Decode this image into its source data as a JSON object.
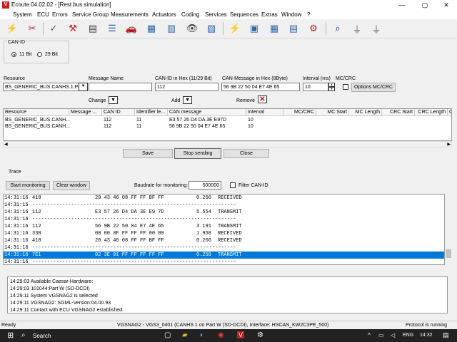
{
  "window": {
    "title": "Ecoute 04.02.02 - [Rest bus simulation]",
    "app_icon": "V",
    "minimize": "—",
    "maximize": "▢",
    "close": "✕"
  },
  "menu": [
    "System",
    "ECU",
    "Errors",
    "Service Group",
    "Measurements",
    "Actuators",
    "Coding",
    "Services",
    "Sequences",
    "Extras",
    "Window",
    "?"
  ],
  "canid": {
    "legend": "CAN-ID",
    "opt11": "11 Bit",
    "opt29": "29 Bit"
  },
  "form": {
    "resource_label": "Resource",
    "resource_value": "BS_GENERIC_BUS.CANHS.1.Part",
    "message_name_label": "Message Name",
    "message_name_value": "",
    "canid_hex_label": "CAN-ID in Hex (11/29 Bit)",
    "canid_hex_value": "112",
    "canmsg_label": "CAN-Message in Hex (8Byte)",
    "canmsg_value": "56 9B 22 50 04 E7 4E 65",
    "interval_label": "Interval (ms)",
    "interval_value": "10",
    "mccrc_label": "MC/CRC",
    "options_button": "Options MC/CRC",
    "change_label": "Change",
    "add_label": "Add",
    "remove_label": "Remove"
  },
  "grid": {
    "headers": [
      "Resource",
      "Message ...",
      "CAN ID",
      "Identifier le...",
      "CAN message",
      "Interval",
      "MC/CRC",
      "MC Start",
      "MC Length",
      "CRC Start",
      "CRC Length",
      "C"
    ],
    "rows": [
      {
        "resource": "BS_GENERIC_BUS.CANH...",
        "canid": "112",
        "idlen": "11",
        "msg": "E3 57 26 D4 DA 3E E97D",
        "interval": "10"
      },
      {
        "resource": "BS_GENERIC_BUS.CANH...",
        "canid": "112",
        "idlen": "11",
        "msg": "56 9B 22 50 04 E7 4E 65",
        "interval": "10"
      }
    ]
  },
  "actions": {
    "save": "Save",
    "stop": "Stop sending",
    "close": "Close"
  },
  "trace": {
    "title": "Trace",
    "start_button": "Start monitoring",
    "clear_button": "Clear window",
    "baud_label": "Baudrate for monitoring:",
    "baud_value": "500000",
    "filter_label": "Filter CAN-ID",
    "lines": [
      {
        "t": "14:31:16",
        "id": "418",
        "data": "20 43 46 08 FF FF BF FF",
        "val": "0.260",
        "dir": "RECEIVED",
        "sel": false
      },
      {
        "t": "14:31:16",
        "id": "--------------------------------------------------------------------",
        "data": "",
        "val": "",
        "dir": "",
        "sel": false
      },
      {
        "t": "14:31:16",
        "id": "112",
        "data": "E3 57 26 D4 DA 3E E9 7D",
        "val": "5.554",
        "dir": "TRANSMIT",
        "sel": false
      },
      {
        "t": "14:31:16",
        "id": "--------------------------------------------------------------------",
        "data": "",
        "val": "",
        "dir": "",
        "sel": false
      },
      {
        "t": "14:31:16",
        "id": "112",
        "data": "56 9B 22 50 04 E7 4E 65",
        "val": "3.191",
        "dir": "TRANSMIT",
        "sel": false
      },
      {
        "t": "14:31:16",
        "id": "338",
        "data": "00 00 0F FF FF FF 00 00",
        "val": "1.958",
        "dir": "RECEIVED",
        "sel": false
      },
      {
        "t": "14:31:16",
        "id": "418",
        "data": "20 43 46 08 FF FF BF FF",
        "val": "0.266",
        "dir": "RECEIVED",
        "sel": false
      },
      {
        "t": "14:31:16",
        "id": "--------------------------------------------------------------------",
        "data": "",
        "val": "",
        "dir": "",
        "sel": false
      },
      {
        "t": "14:31:16",
        "id": "7E1",
        "data": "02 3E 01 FF FF FF FF FF",
        "val": "0.259",
        "dir": "TRANSMIT",
        "sel": true
      },
      {
        "t": "14:31:16",
        "id": "--------------------------------------------------------------------",
        "data": "",
        "val": "",
        "dir": "",
        "sel": false
      }
    ]
  },
  "log": [
    "14:29:03 Available Caesar-Hardware:",
    "14:29:03 101044:Part W (SD-DCDI)",
    "14:29:11 System VGSNAG2 is selected",
    "14:29:11 VGSNAG2: SGML-Version:04.00.93",
    "14:29:11 Contact with ECU VGSNAG2 established."
  ],
  "status": {
    "left": "Ready",
    "middle": "VGSNAG2 - VGS3_0401 (CANHS 1 on Part W (SD-DCDI), Interface: HSCAN_KW2C3PE_500)",
    "right": "Protocol is running"
  },
  "taskbar": {
    "search": "Search",
    "lang": "ENG",
    "time": "14:32"
  },
  "colors": {
    "selection": "#0078d7",
    "remove_x": "#d01010",
    "app_icon": "#c81e1e"
  }
}
